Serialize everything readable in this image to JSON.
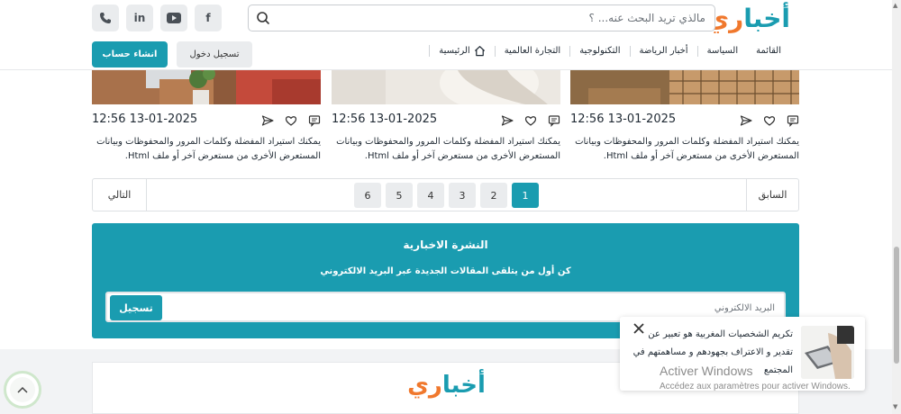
{
  "header": {
    "logo_part1": "أخبا",
    "logo_part2": "ري",
    "search_placeholder": "مالذي تريد البحث عنه... ؟",
    "social": [
      "f",
      "in"
    ],
    "nav": [
      "الرئيسية",
      "التجارة العالمية",
      "التكنولوجية",
      "أخبار الرياضة",
      "السياسة",
      "القائمة"
    ],
    "login_label": "تسجيل دخول",
    "register_label": "انشاء حساب"
  },
  "articles": [
    {
      "date": "12:56 13-01-2025",
      "text": "يمكنك استيراد المفضلة وكلمات المرور والمحفوظات وبيانات المستعرض الأخرى من مستعرض آخر أو ملف Html."
    },
    {
      "date": "12:56 13-01-2025",
      "text": "يمكنك استيراد المفضلة وكلمات المرور والمحفوظات وبيانات المستعرض الأخرى من مستعرض آخر أو ملف Html."
    },
    {
      "date": "12:56 13-01-2025",
      "text": "يمكنك استيراد المفضلة وكلمات المرور والمحفوظات وبيانات المستعرض الأخرى من مستعرض آخر أو ملف Html."
    }
  ],
  "pagination": {
    "prev": "السابق",
    "next": "التالي",
    "pages": [
      "1",
      "2",
      "3",
      "4",
      "5",
      "6"
    ],
    "current": "1"
  },
  "newsletter": {
    "title": "النشرة الاخبارية",
    "subtitle": "كن أول من يتلقى المقالات الجديدة عبر البريد الالكتروني",
    "email_placeholder": "البريد الالكتروني",
    "button": "تسجيل"
  },
  "footer": {
    "logo_part1": "أخبا",
    "logo_part2": "ري"
  },
  "popup": {
    "text": "تكريم الشخصيات المغربية هو تعبير عن تقدير و الاعتراف بجهودهم و مساهمتهم في المجتمع"
  },
  "watermark": {
    "title": "Activer Windows",
    "subtitle": "Accédez aux paramètres pour activer Windows."
  },
  "colors": {
    "accent": "#1a9cb0",
    "logo_orange": "#f0782d"
  }
}
